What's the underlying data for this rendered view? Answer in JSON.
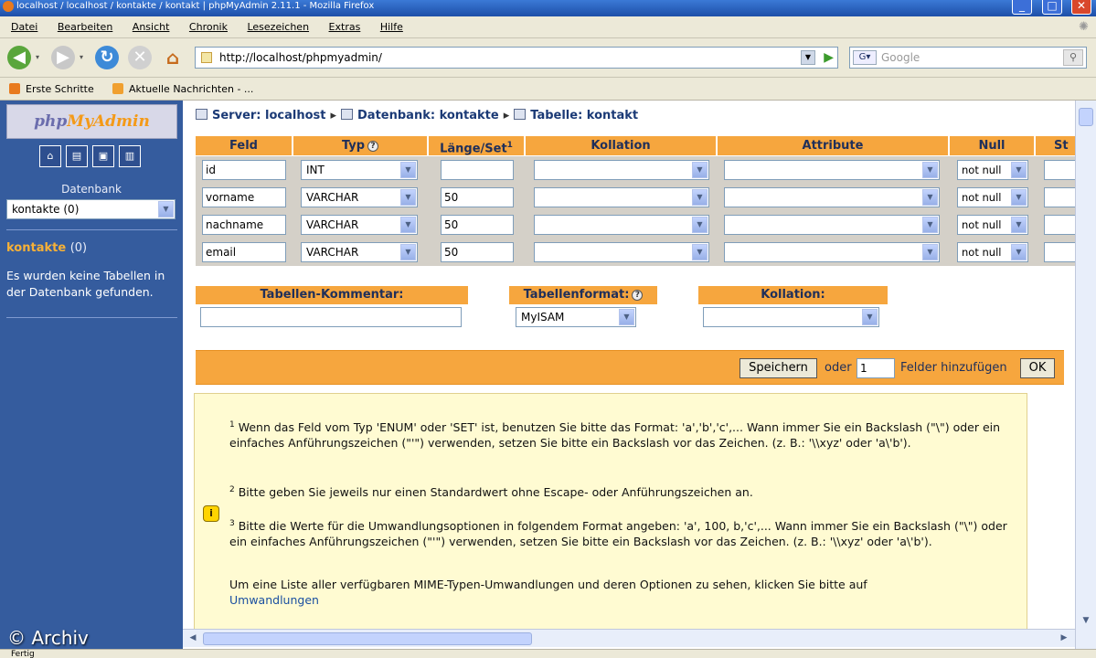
{
  "window": {
    "title": "localhost / localhost / kontakte / kontakt | phpMyAdmin 2.11.1 - Mozilla Firefox"
  },
  "menu": [
    "Datei",
    "Bearbeiten",
    "Ansicht",
    "Chronik",
    "Lesezeichen",
    "Extras",
    "Hilfe"
  ],
  "address": {
    "url": "http://localhost/phpmyadmin/",
    "search_placeholder": "Google"
  },
  "bookmarks": [
    "Erste Schritte",
    "Aktuelle Nachrichten - ..."
  ],
  "sidebar": {
    "logo_part1": "php",
    "logo_part2": "MyAdmin",
    "db_label": "Datenbank",
    "db_select": "kontakte (0)",
    "db_name": "kontakte",
    "db_count": "(0)",
    "message": "Es wurden keine Tabellen in der Datenbank gefunden.",
    "watermark": "© Archiv"
  },
  "breadcrumb": {
    "server": "Server: localhost",
    "database": "Datenbank: kontakte",
    "table": "Tabelle: kontakt"
  },
  "columns": {
    "feld": "Feld",
    "typ": "Typ",
    "laenge": "Länge/Set",
    "laenge_sup": "1",
    "kollation": "Kollation",
    "attribute": "Attribute",
    "null": "Null",
    "standard": "St"
  },
  "rows": [
    {
      "name": "id",
      "type": "INT",
      "length": "",
      "null": "not null"
    },
    {
      "name": "vorname",
      "type": "VARCHAR",
      "length": "50",
      "null": "not null"
    },
    {
      "name": "nachname",
      "type": "VARCHAR",
      "length": "50",
      "null": "not null"
    },
    {
      "name": "email",
      "type": "VARCHAR",
      "length": "50",
      "null": "not null"
    }
  ],
  "table_options": {
    "comment_label": "Tabellen-Kommentar:",
    "comment_value": "",
    "format_label": "Tabellenformat:",
    "format_value": "MyISAM",
    "collation_label": "Kollation:",
    "collation_value": ""
  },
  "actions": {
    "save_label": "Speichern",
    "or_label": "oder",
    "field_count": "1",
    "add_fields_label": "Felder hinzufügen",
    "ok_label": "OK"
  },
  "notes": {
    "note1_sup": "1",
    "note1": "Wenn das Feld vom Typ 'ENUM' oder 'SET' ist, benutzen Sie bitte das Format: 'a','b','c',... Wann immer Sie ein Backslash (\"\\\") oder ein einfaches Anführungszeichen (\"'\") verwenden, setzen Sie bitte ein Backslash vor das Zeichen. (z. B.: '\\\\xyz' oder 'a\\'b').",
    "note2_sup": "2",
    "note2": "Bitte geben Sie jeweils nur einen Standardwert ohne Escape- oder Anführungszeichen an.",
    "note3_sup": "3",
    "note3": "Bitte die Werte für die Umwandlungsoptionen in folgendem Format angeben: 'a', 100, b,'c',... Wann immer Sie ein Backslash (\"\\\") oder ein einfaches Anführungszeichen (\"'\") verwenden, setzen Sie bitte ein Backslash vor das Zeichen. (z. B.: '\\\\xyz' oder 'a\\'b').",
    "note4": "Um eine Liste aller verfügbaren MIME-Typen-Umwandlungen und deren Optionen zu sehen, klicken Sie bitte auf",
    "link": "Umwandlungen"
  },
  "status": {
    "text": "Fertig"
  },
  "colors": {
    "header_orange": "#f6a63e",
    "sidebar_blue": "#355c9e",
    "notes_yellow": "#fffbd2"
  }
}
